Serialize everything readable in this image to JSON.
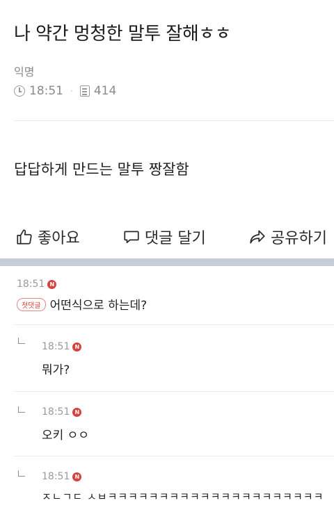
{
  "post": {
    "title": "나 약간 멍청한 말투 잘해ㅎㅎ",
    "author": "익명",
    "time": "18:51",
    "views": "414",
    "body": "답답하게 만드는 말투 짱잘함"
  },
  "actions": {
    "like": "좋아요",
    "comment": "댓글 달기",
    "share": "공유하기"
  },
  "comments": [
    {
      "time": "18:51",
      "badge": "N",
      "tag": "첫댓글",
      "text": "어떤식으로 하는데?"
    },
    {
      "time": "18:51",
      "badge": "N",
      "text": "뭐가?"
    },
    {
      "time": "18:51",
      "badge": "N",
      "text": "오키 ㅇㅇ"
    },
    {
      "time": "18:51",
      "badge": "N",
      "text": "ㅈㄴㄱㄷ ㅅㅂㅋㅋㅋㅋㅋㅋㅋㅋㅋㅋㅋㅋㅋㅋㅋㅋㅋㅋㅋㅋㅋ"
    }
  ],
  "colors": {
    "badge": "#d6433e",
    "divider": "#c7cdd6"
  }
}
